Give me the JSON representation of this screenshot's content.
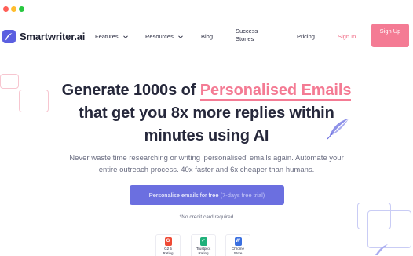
{
  "window": {
    "controls": [
      "close",
      "minimize",
      "maximize"
    ]
  },
  "brand": {
    "name": "Smartwriter.ai",
    "logo_icon": "feather-pen-icon",
    "accent": "#5b5fe0",
    "pink": "#f47b94"
  },
  "nav": {
    "features": "Features",
    "resources": "Resources",
    "blog": "Blog",
    "success_stories": "Success Stories",
    "pricing": "Pricing",
    "sign_in": "Sign In",
    "sign_up": "Sign Up"
  },
  "hero": {
    "line1_prefix": "Generate 1000s of ",
    "line1_highlight": "Personalised Emails",
    "line2": "that get you 8x more replies within",
    "line3": "minutes using AI",
    "subtitle_1": "Never waste time researching or writing 'personalised' emails again. Automate your",
    "subtitle_2": "entire outreach process. 40x faster and 6x cheaper than humans."
  },
  "cta": {
    "label": "Personalise emails for free",
    "trial": "(7-days free trial)",
    "note": "*No credit card required"
  },
  "badges": [
    {
      "icon_text": "G",
      "line1": "G2 5",
      "line2": "Rating"
    },
    {
      "icon_text": "✓",
      "line1": "Trustpilot",
      "line2": "Rating"
    },
    {
      "icon_text": "W",
      "line1": "Chrome",
      "line2": "Store"
    }
  ]
}
